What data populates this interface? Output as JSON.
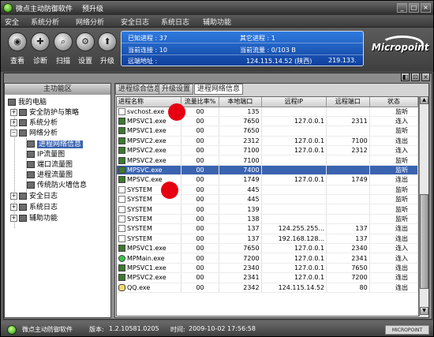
{
  "window": {
    "title": "微点主动防御软件",
    "upgrade": "预升级",
    "btn_min": "_",
    "btn_max": "□",
    "btn_close": "×"
  },
  "menu": [
    "安全",
    "系统分析",
    "网络分析",
    "安全日志",
    "系统日志",
    "辅助功能"
  ],
  "toolbar": {
    "buttons": [
      "查看",
      "诊断",
      "扫描",
      "设置",
      "升级"
    ]
  },
  "info": {
    "known_proc_label": "已知进程 : 37",
    "other_proc_label": "其它进程 : 1",
    "cur_conn_label": "当前连接 : 10",
    "cur_traffic_label": "当前流量 : 0/103 B",
    "remote_addr_label": "远端地址 :",
    "remote_addr_value": "124.115.14.52 (陕西)",
    "remote_addr_extra": "219.133."
  },
  "logo": {
    "text": "Micropoint"
  },
  "left_panel": {
    "header": "主功能区",
    "tree": {
      "root": "我的电脑",
      "n1": "安全防护与策略",
      "n2": "系统分析",
      "n3": "网络分析",
      "n3_1": "进程网络信息",
      "n3_2": "IP流量图",
      "n3_3": "端口流量图",
      "n3_4": "进程流量图",
      "n3_5": "传统防火墙信息",
      "n4": "安全日志",
      "n5": "系统日志",
      "n6": "辅助功能"
    }
  },
  "tabs": [
    "进程综合信息",
    "升级设置",
    "进程网络信息"
  ],
  "panel_controls": [
    "◧",
    "⊡",
    "×"
  ],
  "table": {
    "headers": [
      "进程名称",
      "流量比率%",
      "本地端口",
      "远程IP",
      "远程端口",
      "状态"
    ],
    "rows": [
      {
        "icon": "w",
        "name": "svchost.exe",
        "ratio": "00",
        "lport": "135",
        "rip": "",
        "rport": "",
        "state": "监听"
      },
      {
        "icon": "d",
        "name": "MPSVC1.exe",
        "ratio": "00",
        "lport": "7650",
        "rip": "127.0.0.1",
        "rport": "2311",
        "state": "连入"
      },
      {
        "icon": "d",
        "name": "MPSVC1.exe",
        "ratio": "00",
        "lport": "7650",
        "rip": "",
        "rport": "",
        "state": "监听"
      },
      {
        "icon": "d",
        "name": "MPSVC2.exe",
        "ratio": "00",
        "lport": "2312",
        "rip": "127.0.0.1",
        "rport": "7100",
        "state": "连出"
      },
      {
        "icon": "d",
        "name": "MPSVC2.exe",
        "ratio": "00",
        "lport": "7100",
        "rip": "127.0.0.1",
        "rport": "2312",
        "state": "连入"
      },
      {
        "icon": "d",
        "name": "MPSVC2.exe",
        "ratio": "00",
        "lport": "7100",
        "rip": "",
        "rport": "",
        "state": "监听"
      },
      {
        "icon": "d",
        "name": "MPSVC.exe",
        "ratio": "00",
        "lport": "7400",
        "rip": "",
        "rport": "",
        "state": "监听",
        "selected": true
      },
      {
        "icon": "d",
        "name": "MPSVC.exe",
        "ratio": "00",
        "lport": "1749",
        "rip": "127.0.0.1",
        "rport": "1749",
        "state": "连出"
      },
      {
        "icon": "w",
        "name": "SYSTEM",
        "ratio": "00",
        "lport": "445",
        "rip": "",
        "rport": "",
        "state": "监听"
      },
      {
        "icon": "w",
        "name": "SYSTEM",
        "ratio": "00",
        "lport": "445",
        "rip": "",
        "rport": "",
        "state": "监听"
      },
      {
        "icon": "w",
        "name": "SYSTEM",
        "ratio": "00",
        "lport": "139",
        "rip": "",
        "rport": "",
        "state": "监听"
      },
      {
        "icon": "w",
        "name": "SYSTEM",
        "ratio": "00",
        "lport": "138",
        "rip": "",
        "rport": "",
        "state": "监听"
      },
      {
        "icon": "w",
        "name": "SYSTEM",
        "ratio": "00",
        "lport": "137",
        "rip": "124.255.255...",
        "rport": "137",
        "state": "连出"
      },
      {
        "icon": "w",
        "name": "SYSTEM",
        "ratio": "00",
        "lport": "137",
        "rip": "192.168.128...",
        "rport": "137",
        "state": "连出"
      },
      {
        "icon": "d",
        "name": "MPSVC1.exe",
        "ratio": "00",
        "lport": "7650",
        "rip": "127.0.0.1",
        "rport": "2340",
        "state": "连入"
      },
      {
        "icon": "g",
        "name": "MPMain.exe",
        "ratio": "00",
        "lport": "7200",
        "rip": "127.0.0.1",
        "rport": "2341",
        "state": "连入"
      },
      {
        "icon": "d",
        "name": "MPSVC1.exe",
        "ratio": "00",
        "lport": "2340",
        "rip": "127.0.0.1",
        "rport": "7650",
        "state": "连出"
      },
      {
        "icon": "d",
        "name": "MPSVC2.exe",
        "ratio": "00",
        "lport": "2341",
        "rip": "127.0.0.1",
        "rport": "7200",
        "state": "连出"
      },
      {
        "icon": "q",
        "name": "QQ.exe",
        "ratio": "00",
        "lport": "2342",
        "rip": "124.115.14.52",
        "rport": "80",
        "state": "连出"
      }
    ]
  },
  "scroll": {
    "up": "▲",
    "down": "▼"
  },
  "status": {
    "app": "微点主动防御软件",
    "version_label": "版本:",
    "version": "1.2.10581.0205",
    "time_label": "时间:",
    "time": "2009-10-02 17:56:58",
    "brand": "MICROPOINT"
  }
}
